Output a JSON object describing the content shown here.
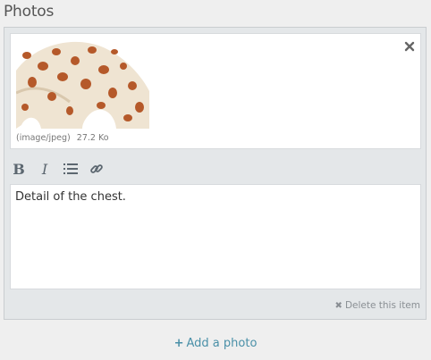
{
  "section": {
    "title": "Photos"
  },
  "photo": {
    "mime": "(image/jpeg)",
    "size": "27.2 Ko",
    "caption": "Detail of the chest."
  },
  "toolbar": {
    "bold_label": "B",
    "italic_label": "I"
  },
  "actions": {
    "delete_label": "Delete this item",
    "add_label": "Add a photo"
  },
  "colors": {
    "accent": "#4a90a8",
    "panel_bg": "#e4e7e9",
    "page_bg": "#efefef"
  }
}
